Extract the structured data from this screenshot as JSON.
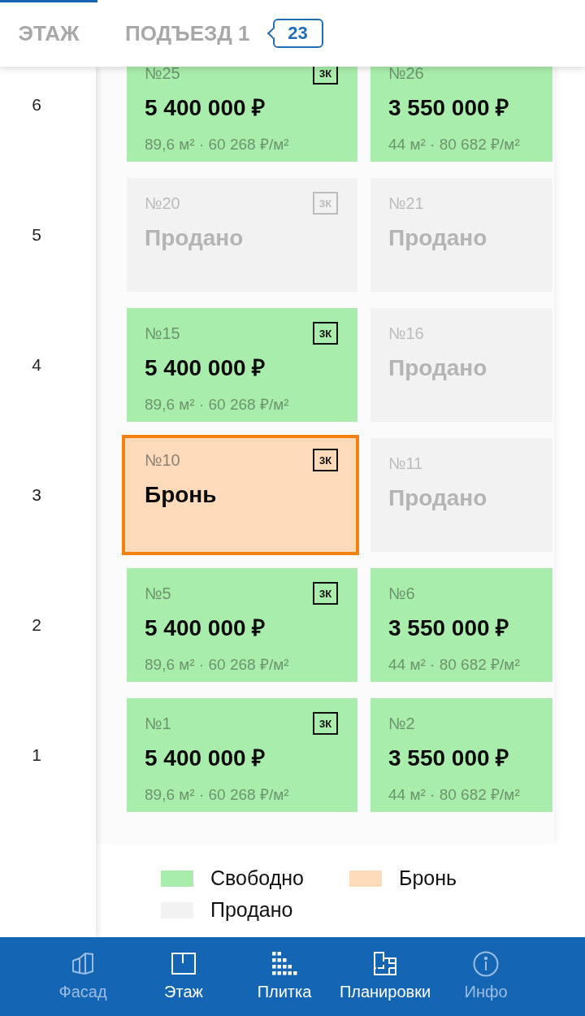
{
  "header": {
    "tabs": [
      {
        "label": "ЭТАЖ",
        "selected": true
      },
      {
        "label": "ПОДЪЕЗД 1",
        "selected": false,
        "badge": "23"
      }
    ]
  },
  "floors": [
    {
      "label": "6",
      "apartments": [
        {
          "number": "№25",
          "kind": "free",
          "selected": false,
          "rooms": "3К",
          "price": "5 400 000 ₽",
          "details": "89,6 м² · 60 268 ₽/м²"
        },
        {
          "number": "№26",
          "kind": "free",
          "selected": false,
          "price": "3 550 000 ₽",
          "details": "44 м² · 80 682 ₽/м²"
        }
      ]
    },
    {
      "label": "5",
      "apartments": [
        {
          "number": "№20",
          "kind": "sold",
          "selected": false,
          "rooms": "3К",
          "status": "Продано"
        },
        {
          "number": "№21",
          "kind": "sold",
          "selected": false,
          "status": "Продано"
        }
      ]
    },
    {
      "label": "4",
      "apartments": [
        {
          "number": "№15",
          "kind": "free",
          "selected": false,
          "rooms": "3К",
          "price": "5 400 000 ₽",
          "details": "89,6 м² · 60 268 ₽/м²"
        },
        {
          "number": "№16",
          "kind": "sold",
          "selected": false,
          "status": "Продано"
        }
      ]
    },
    {
      "label": "3",
      "apartments": [
        {
          "number": "№10",
          "kind": "reserved",
          "selected": true,
          "rooms": "3К",
          "status": "Бронь"
        },
        {
          "number": "№11",
          "kind": "sold",
          "selected": false,
          "status": "Продано"
        }
      ]
    },
    {
      "label": "2",
      "apartments": [
        {
          "number": "№5",
          "kind": "free",
          "selected": false,
          "rooms": "3К",
          "price": "5 400 000 ₽",
          "details": "89,6 м² · 60 268 ₽/м²"
        },
        {
          "number": "№6",
          "kind": "free",
          "selected": false,
          "price": "3 550 000 ₽",
          "details": "44 м² · 80 682 ₽/м²"
        }
      ]
    },
    {
      "label": "1",
      "apartments": [
        {
          "number": "№1",
          "kind": "free",
          "selected": false,
          "rooms": "3К",
          "price": "5 400 000 ₽",
          "details": "89,6 м² · 60 268 ₽/м²"
        },
        {
          "number": "№2",
          "kind": "free",
          "selected": false,
          "price": "3 550 000 ₽",
          "details": "44 м² · 80 682 ₽/м²"
        }
      ]
    }
  ],
  "legend": [
    {
      "label": "Свободно",
      "color": "#a8edab"
    },
    {
      "label": "Бронь",
      "color": "#fddbba"
    },
    {
      "label": "Продано",
      "color": "#f2f2f2"
    }
  ],
  "nav": [
    {
      "label": "Фасад",
      "disabled": true
    },
    {
      "label": "Этаж",
      "disabled": false
    },
    {
      "label": "Плитка",
      "disabled": false
    },
    {
      "label": "Планировки",
      "disabled": false
    },
    {
      "label": "Инфо",
      "disabled": true
    }
  ]
}
